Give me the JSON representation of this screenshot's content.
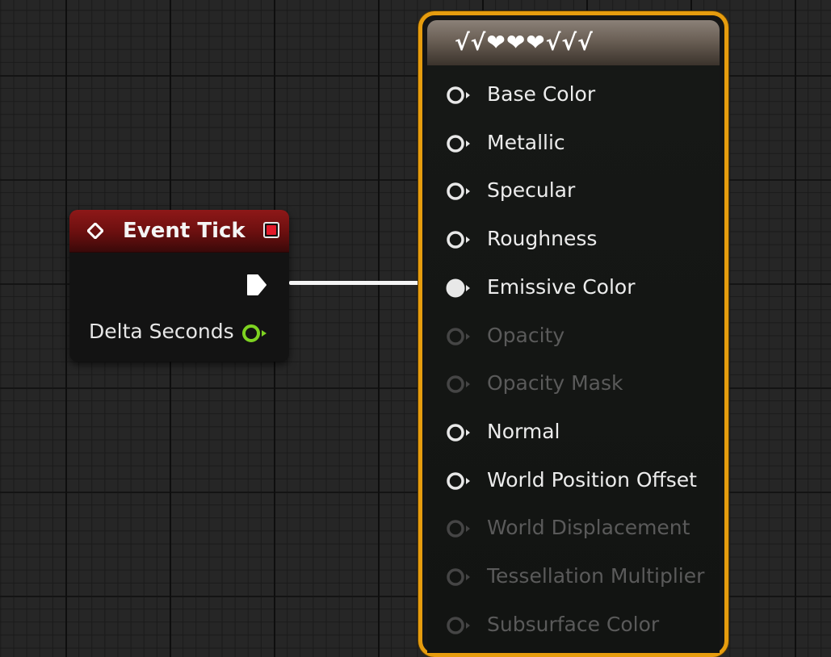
{
  "event_node": {
    "title": "Event Tick",
    "output_label": "Delta Seconds",
    "header_color": "#8e1818",
    "pin_color": "#7ed321"
  },
  "material_node": {
    "title": "√√❤❤❤√√√",
    "border_color": "#e69c0e",
    "pins": [
      {
        "label": "Base Color",
        "enabled": true,
        "connected": false
      },
      {
        "label": "Metallic",
        "enabled": true,
        "connected": false
      },
      {
        "label": "Specular",
        "enabled": true,
        "connected": false
      },
      {
        "label": "Roughness",
        "enabled": true,
        "connected": false
      },
      {
        "label": "Emissive Color",
        "enabled": true,
        "connected": true
      },
      {
        "label": "Opacity",
        "enabled": false,
        "connected": false
      },
      {
        "label": "Opacity Mask",
        "enabled": false,
        "connected": false
      },
      {
        "label": "Normal",
        "enabled": true,
        "connected": false
      },
      {
        "label": "World Position Offset",
        "enabled": true,
        "connected": false
      },
      {
        "label": "World Displacement",
        "enabled": false,
        "connected": false
      },
      {
        "label": "Tessellation Multiplier",
        "enabled": false,
        "connected": false
      },
      {
        "label": "Subsurface Color",
        "enabled": false,
        "connected": false
      }
    ]
  }
}
